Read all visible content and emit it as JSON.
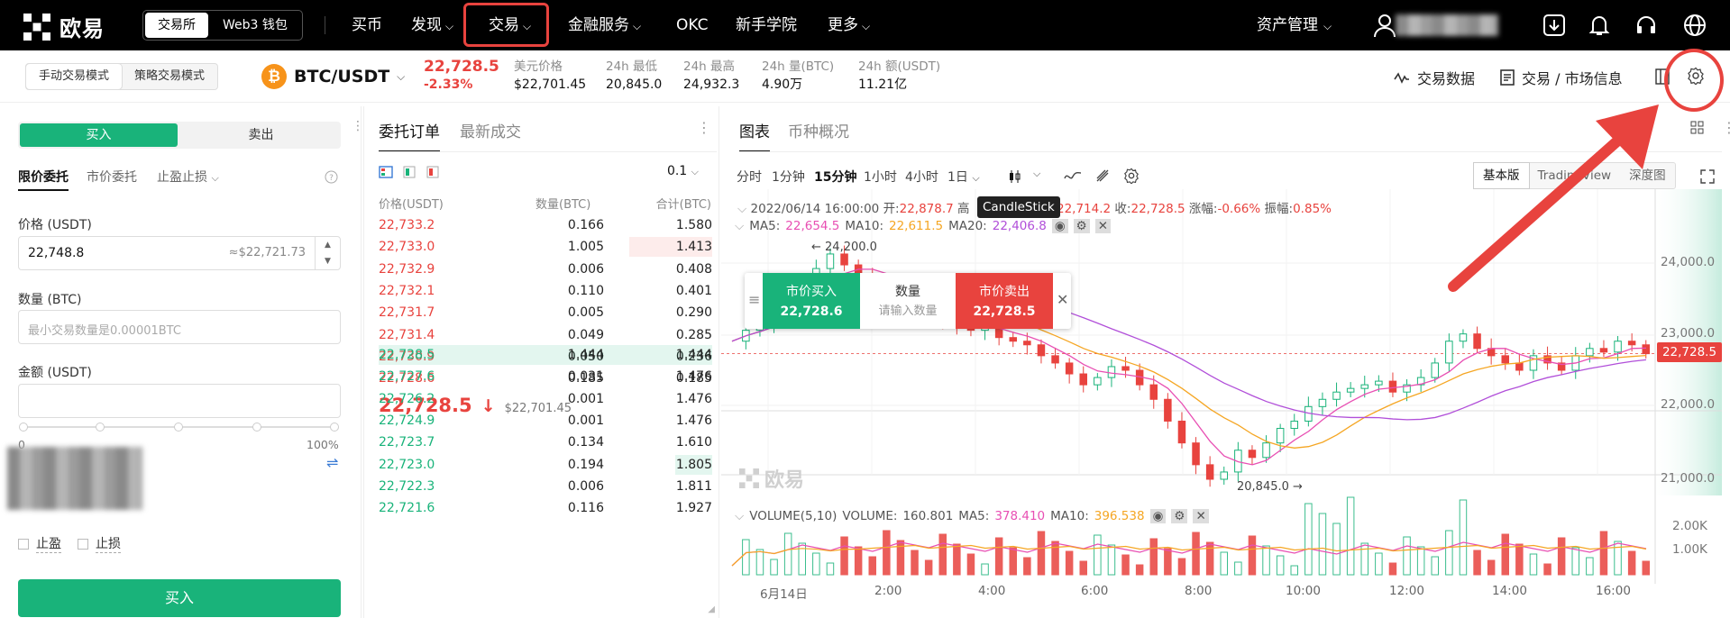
{
  "nav": {
    "brand": "欧易",
    "tab_exchange": "交易所",
    "tab_web3": "Web3 钱包",
    "menu": [
      "买币",
      "发现",
      "交易",
      "金融服务",
      "OKC",
      "新手学院",
      "更多"
    ],
    "asset": "资产管理"
  },
  "subbar": {
    "mode_manual": "手动交易模式",
    "mode_strategy": "策略交易模式",
    "pair": "BTC/USDT",
    "last_price": "22,728.5",
    "change_pct": "-2.33%",
    "usd_label": "美元价格",
    "usd_value": "$22,701.45",
    "low_label": "24h 最低",
    "low_value": "20,845.0",
    "high_label": "24h 最高",
    "high_value": "24,932.3",
    "vol_label": "24h 量(BTC)",
    "vol_value": "4.90万",
    "amt_label": "24h 额(USDT)",
    "amt_value": "11.21亿",
    "trade_data": "交易数据",
    "market_info": "交易 / 市场信息"
  },
  "order_form": {
    "buy_tab": "买入",
    "sell_tab": "卖出",
    "type_limit": "限价委托",
    "type_market": "市价委托",
    "type_tpsl": "止盈止损",
    "price_label": "价格 (USDT)",
    "price_value": "22,748.8",
    "price_approx": "≈$22,721.73",
    "qty_label": "数量 (BTC)",
    "qty_placeholder": "最小交易数量是0.00001BTC",
    "amount_label": "金额 (USDT)",
    "slider_min": "0",
    "slider_max": "100%",
    "tp_label": "止盈",
    "sl_label": "止损",
    "submit": "买入"
  },
  "orderbook": {
    "tab_orders": "委托订单",
    "tab_trades": "最新成交",
    "precision": "0.1",
    "col_price": "价格(USDT)",
    "col_qty": "数量(BTC)",
    "col_total": "合计(BTC)",
    "asks": [
      {
        "price": "22,733.2",
        "qty": "0.166",
        "total": "1.580",
        "depth": 0.0
      },
      {
        "price": "22,733.0",
        "qty": "1.005",
        "total": "1.413",
        "depth": 0.25
      },
      {
        "price": "22,732.9",
        "qty": "0.006",
        "total": "0.408",
        "depth": 0.0
      },
      {
        "price": "22,732.1",
        "qty": "0.110",
        "total": "0.401",
        "depth": 0.0
      },
      {
        "price": "22,731.7",
        "qty": "0.005",
        "total": "0.290",
        "depth": 0.0
      },
      {
        "price": "22,731.4",
        "qty": "0.049",
        "total": "0.285",
        "depth": 0.0
      },
      {
        "price": "22,730.9",
        "qty": "0.050",
        "total": "0.236",
        "depth": 0.0
      },
      {
        "price": "22,728.6",
        "qty": "0.185",
        "total": "0.185",
        "depth": 0.0
      }
    ],
    "mid_price": "22,728.5",
    "mid_usd": "$22,701.45",
    "bids": [
      {
        "price": "22,728.5",
        "qty": "1.444",
        "total": "1.444",
        "depth": 1.0
      },
      {
        "price": "22,727.6",
        "qty": "0.031",
        "total": "1.476",
        "depth": 0.0
      },
      {
        "price": "22,726.2",
        "qty": "0.001",
        "total": "1.476",
        "depth": 0.0
      },
      {
        "price": "22,724.9",
        "qty": "0.001",
        "total": "1.476",
        "depth": 0.0
      },
      {
        "price": "22,723.7",
        "qty": "0.134",
        "total": "1.610",
        "depth": 0.0
      },
      {
        "price": "22,723.0",
        "qty": "0.194",
        "total": "1.805",
        "depth": 0.11
      },
      {
        "price": "22,722.3",
        "qty": "0.006",
        "total": "1.811",
        "depth": 0.0
      },
      {
        "price": "22,721.6",
        "qty": "0.116",
        "total": "1.927",
        "depth": 0.0
      }
    ]
  },
  "chart_panel": {
    "tab_chart": "图表",
    "tab_overview": "币种概况",
    "intervals": [
      "分时",
      "1分钟",
      "15分钟",
      "1小时",
      "4小时",
      "1日"
    ],
    "mode_basic": "基本版",
    "mode_tv": "TradingView",
    "mode_depth": "深度图",
    "tooltip": "CandleStick",
    "ohlc": {
      "date": "2022/06/14 16:00:00",
      "open_label": "开:",
      "open": "22,878.7",
      "high_label": "高",
      "low_value": "22,714.2",
      "close_label": "收:",
      "close": "22,728.5",
      "chg_label": "涨幅:",
      "chg": "-0.66%",
      "amp_label": "振幅:",
      "amp": "0.85%"
    },
    "ma": {
      "ma5_label": "MA5:",
      "ma5": "22,654.5",
      "ma10_label": "MA10:",
      "ma10": "22,611.5",
      "ma20_label": "MA20:",
      "ma20": "22,406.8"
    },
    "quick": {
      "buy": "市价买入",
      "buy_price": "22,728.6",
      "qty": "数量",
      "qty_placeholder": "请输入数量",
      "sell": "市价卖出",
      "sell_price": "22,728.5"
    },
    "high_mark": "24,200.0",
    "low_mark": "20,845.0",
    "price_tag": "22,728.5",
    "y_ticks": [
      "24,000.0",
      "23,000.0",
      "22,000.0",
      "21,000.0"
    ],
    "volume": {
      "label": "VOLUME(5,10)",
      "vol_label": "VOLUME:",
      "vol": "160.801",
      "ma5_label": "MA5:",
      "ma5": "378.410",
      "ma10_label": "MA10:",
      "ma10": "396.538"
    },
    "vol_ticks": [
      "2.00K",
      "1.00K"
    ],
    "x_ticks": [
      "6月14日",
      "2:00",
      "4:00",
      "6:00",
      "8:00",
      "10:00",
      "12:00",
      "14:00",
      "16:00"
    ],
    "watermark": "欧易",
    "colors": {
      "up": "#19b37a",
      "down": "#e8433e",
      "ma5": "#f5a623",
      "ma10": "#e84fb3",
      "ma20": "#9b59b6"
    }
  }
}
